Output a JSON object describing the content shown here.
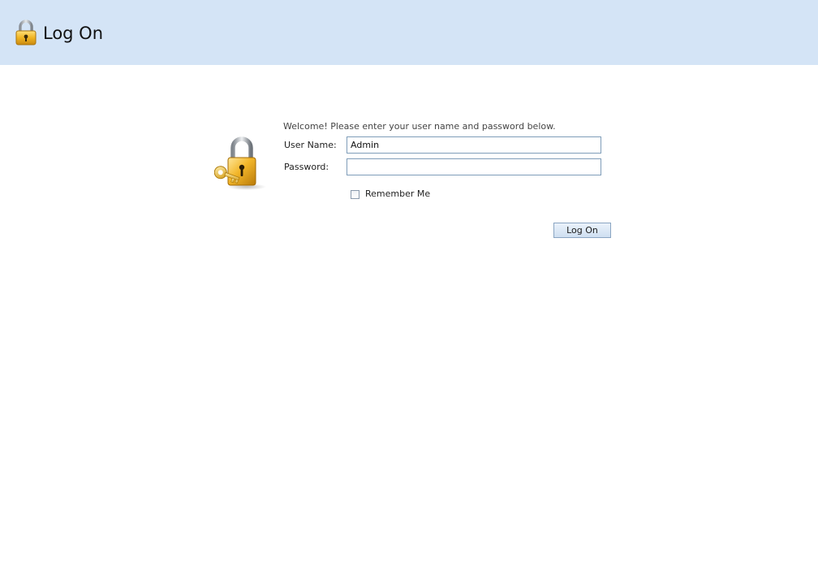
{
  "header": {
    "title": "Log On",
    "icon": "lock-icon",
    "background": "#d4e4f6"
  },
  "form": {
    "welcome_text": "Welcome! Please enter your user name and password below.",
    "username_label": "User Name:",
    "username_value": "Admin",
    "password_label": "Password:",
    "password_value": "",
    "remember_label": "Remember Me",
    "remember_checked": false,
    "submit_label": "Log On",
    "icon": "lock-with-key-icon"
  }
}
